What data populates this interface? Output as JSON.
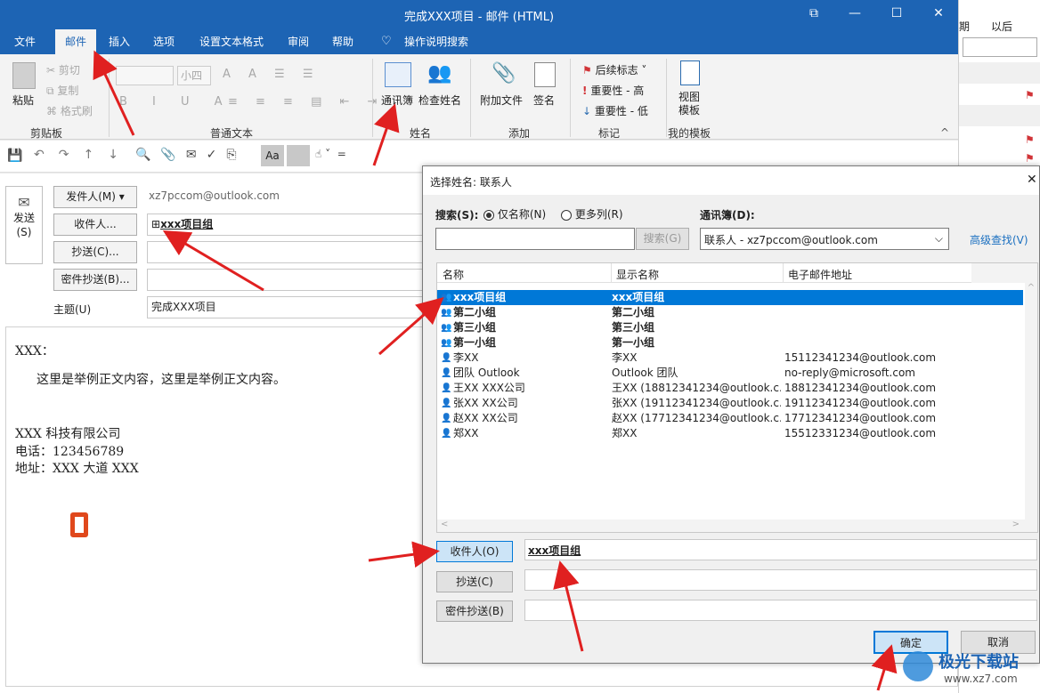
{
  "window": {
    "title": "完成XXX项目  -  邮件 (HTML)"
  },
  "menu_tabs": [
    "文件",
    "邮件",
    "插入",
    "选项",
    "设置文本格式",
    "审阅",
    "帮助",
    "操作说明搜索"
  ],
  "ribbon": {
    "paste": "粘贴",
    "cut": "剪切",
    "copy": "复制",
    "format_painter": "格式刷",
    "clipboard_group": "剪贴板",
    "font_size": "小四",
    "basic_text_group": "普通文本",
    "address_book": "通讯簿",
    "check_names": "检查姓名",
    "names_group": "姓名",
    "attach_file": "附加文件",
    "signature": "签名",
    "add_group": "添加",
    "follow_up": "后续标志",
    "high_importance": "重要性 - 高",
    "low_importance": "重要性 - 低",
    "tags_group": "标记",
    "view_templates": "视图\n模板",
    "my_templates_group": "我的模板"
  },
  "compose": {
    "send": "发送\n(S)",
    "from_btn": "发件人(M)",
    "from_value": "xz7pccom@outlook.com",
    "to_btn": "收件人...",
    "to_value": "xxx项目组",
    "cc_btn": "抄送(C)...",
    "bcc_btn": "密件抄送(B)...",
    "subject_label": "主题(U)",
    "subject_value": "完成XXX项目",
    "body": [
      "XXX：",
      "这里是举例正文内容，这里是举例正文内容。",
      "XXX 科技有限公司",
      "电话：123456789",
      "地址：XXX 大道 XXX"
    ]
  },
  "right_panel": {
    "col1": "期",
    "col2": "以后"
  },
  "dialog": {
    "title": "选择姓名: 联系人",
    "search_label": "搜索(S):",
    "radio_name_only": "仅名称(N)",
    "radio_more_cols": "更多列(R)",
    "address_book_label": "通讯簿(D):",
    "address_book_value": "联系人 - xz7pccom@outlook.com",
    "advanced_find": "高级查找(V)",
    "search_btn": "搜索(G)",
    "columns": [
      "名称",
      "显示名称",
      "电子邮件地址"
    ],
    "rows": [
      {
        "name": "xxx项目组",
        "display": "xxx项目组",
        "email": "",
        "group": true
      },
      {
        "name": "第二小组",
        "display": "第二小组",
        "email": "",
        "group": true
      },
      {
        "name": "第三小组",
        "display": "第三小组",
        "email": "",
        "group": true
      },
      {
        "name": "第一小组",
        "display": "第一小组",
        "email": "",
        "group": true
      },
      {
        "name": "李XX",
        "display": "李XX",
        "email": "15112341234@outlook.com",
        "group": false
      },
      {
        "name": "团队 Outlook",
        "display": "Outlook 团队",
        "email": "no-reply@microsoft.com",
        "group": false
      },
      {
        "name": "王XX XXX公司",
        "display": "王XX (18812341234@outlook.c...",
        "email": "18812341234@outlook.com",
        "group": false
      },
      {
        "name": "张XX XX公司",
        "display": "张XX (19112341234@outlook.c...",
        "email": "19112341234@outlook.com",
        "group": false
      },
      {
        "name": "赵XX XX公司",
        "display": "赵XX (17712341234@outlook.c...",
        "email": "17712341234@outlook.com",
        "group": false
      },
      {
        "name": "郑XX",
        "display": "郑XX",
        "email": "15512331234@outlook.com",
        "group": false
      }
    ],
    "to_btn": "收件人(O)",
    "to_value": "xxx项目组",
    "cc_btn": "抄送(C)",
    "bcc_btn": "密件抄送(B)",
    "ok": "确定",
    "cancel": "取消"
  },
  "watermark": {
    "text": "极光下载站",
    "url": "www.xz7.com"
  }
}
